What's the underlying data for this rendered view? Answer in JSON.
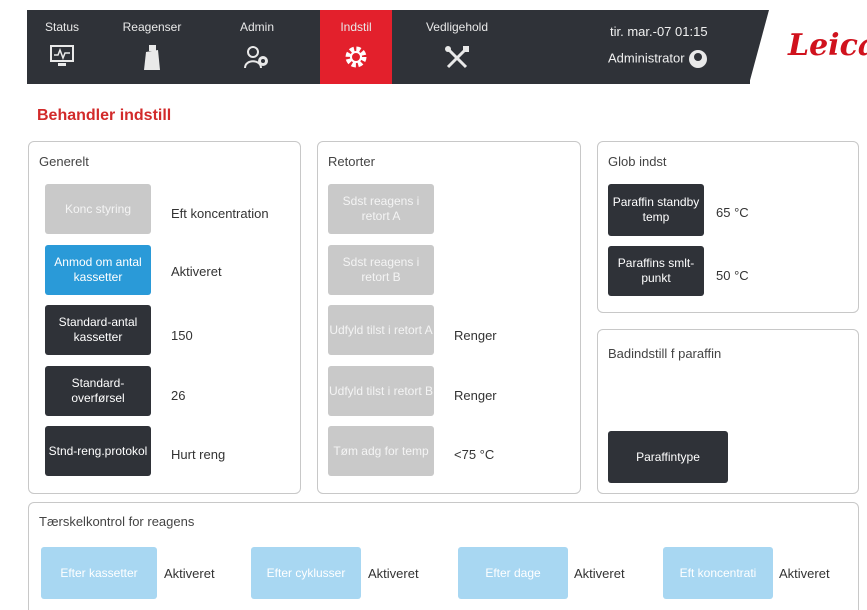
{
  "nav": {
    "tabs": [
      {
        "label": "Status",
        "icon": "status-monitor-icon"
      },
      {
        "label": "Reagenser",
        "icon": "reagent-bottle-icon"
      },
      {
        "label": "Admin",
        "icon": "admin-gear-person-icon"
      },
      {
        "label": "Indstil",
        "icon": "settings-gear-icon",
        "active": true
      },
      {
        "label": "Vedligehold",
        "icon": "maintenance-tools-icon"
      }
    ],
    "datetime": "tir. mar.-07 01:15",
    "user": "Administrator",
    "logo": "Leica",
    "active_color": "#e3202c",
    "bar_color": "#2f3238"
  },
  "page": {
    "title": "Behandler indstill"
  },
  "general": {
    "title": "Generelt",
    "rows": [
      {
        "button": "Konc styring",
        "value": "Eft koncentration"
      },
      {
        "button": "Anmod om antal kassetter",
        "value": "Aktiveret"
      },
      {
        "button": "Standard-antal kassetter",
        "value": "150"
      },
      {
        "button": "Standard-overførsel",
        "value": "26"
      },
      {
        "button": "Stnd-reng.protokol",
        "value": "Hurt reng"
      }
    ]
  },
  "retorts": {
    "title": "Retorter",
    "rows": [
      {
        "button": "Sdst reagens i retort A",
        "value": ""
      },
      {
        "button": "Sdst reagens i retort B",
        "value": ""
      },
      {
        "button": "Udfyld tilst i retort A",
        "value": "Renger"
      },
      {
        "button": "Udfyld tilst i retort B",
        "value": "Renger"
      },
      {
        "button": "Tøm adg for temp",
        "value": "<75 °C"
      }
    ]
  },
  "global": {
    "title": "Glob indst",
    "rows": [
      {
        "button": "Paraffin standby temp",
        "value": "65 °C"
      },
      {
        "button": "Paraffins smlt-punkt",
        "value": "50 °C"
      }
    ]
  },
  "bath": {
    "title": "Badindstill f paraffin",
    "button": "Paraffintype"
  },
  "threshold": {
    "title": "Tærskelkontrol for reagens",
    "items": [
      {
        "button": "Efter kassetter",
        "value": "Aktiveret"
      },
      {
        "button": "Efter cyklusser",
        "value": "Aktiveret"
      },
      {
        "button": "Efter dage",
        "value": "Aktiveret"
      },
      {
        "button": "Eft koncentrati",
        "value": "Aktiveret"
      }
    ]
  }
}
